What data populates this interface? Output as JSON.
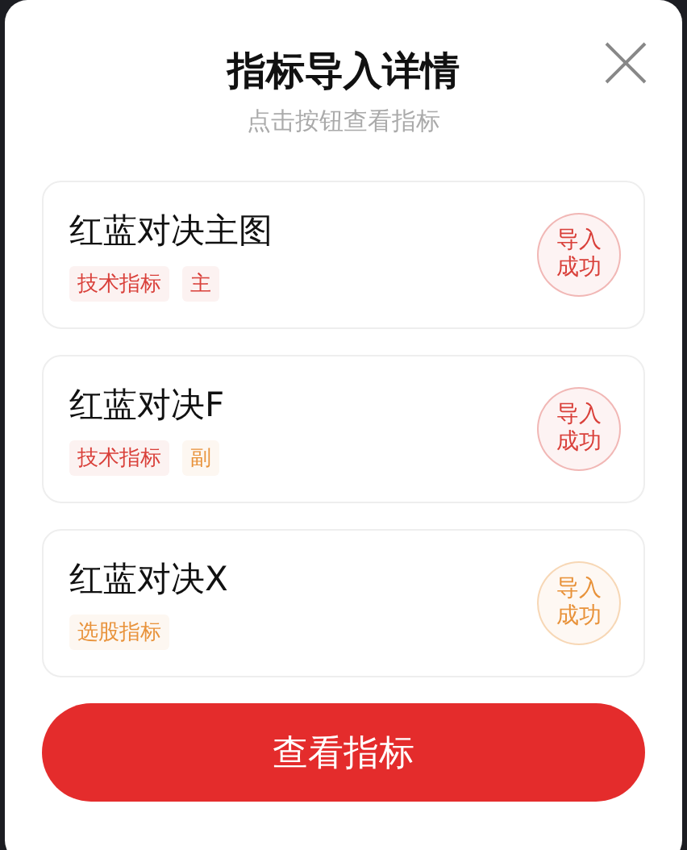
{
  "dialog": {
    "title": "指标导入详情",
    "subtitle": "点击按钮查看指标"
  },
  "items": [
    {
      "name": "红蓝对决主图",
      "tags": [
        {
          "label": "技术指标",
          "color": "#d9403a"
        },
        {
          "label": "主",
          "color": "#d9403a"
        }
      ],
      "status": {
        "label": "导入成功",
        "color": "#d9403a"
      }
    },
    {
      "name": "红蓝对决F",
      "tags": [
        {
          "label": "技术指标",
          "color": "#d9403a"
        },
        {
          "label": "副",
          "color": "#e8923a"
        }
      ],
      "status": {
        "label": "导入成功",
        "color": "#d9403a"
      }
    },
    {
      "name": "红蓝对决X",
      "tags": [
        {
          "label": "选股指标",
          "color": "#e8923a"
        }
      ],
      "status": {
        "label": "导入成功",
        "color": "#e8923a"
      }
    }
  ],
  "button": {
    "label": "查看指标"
  }
}
